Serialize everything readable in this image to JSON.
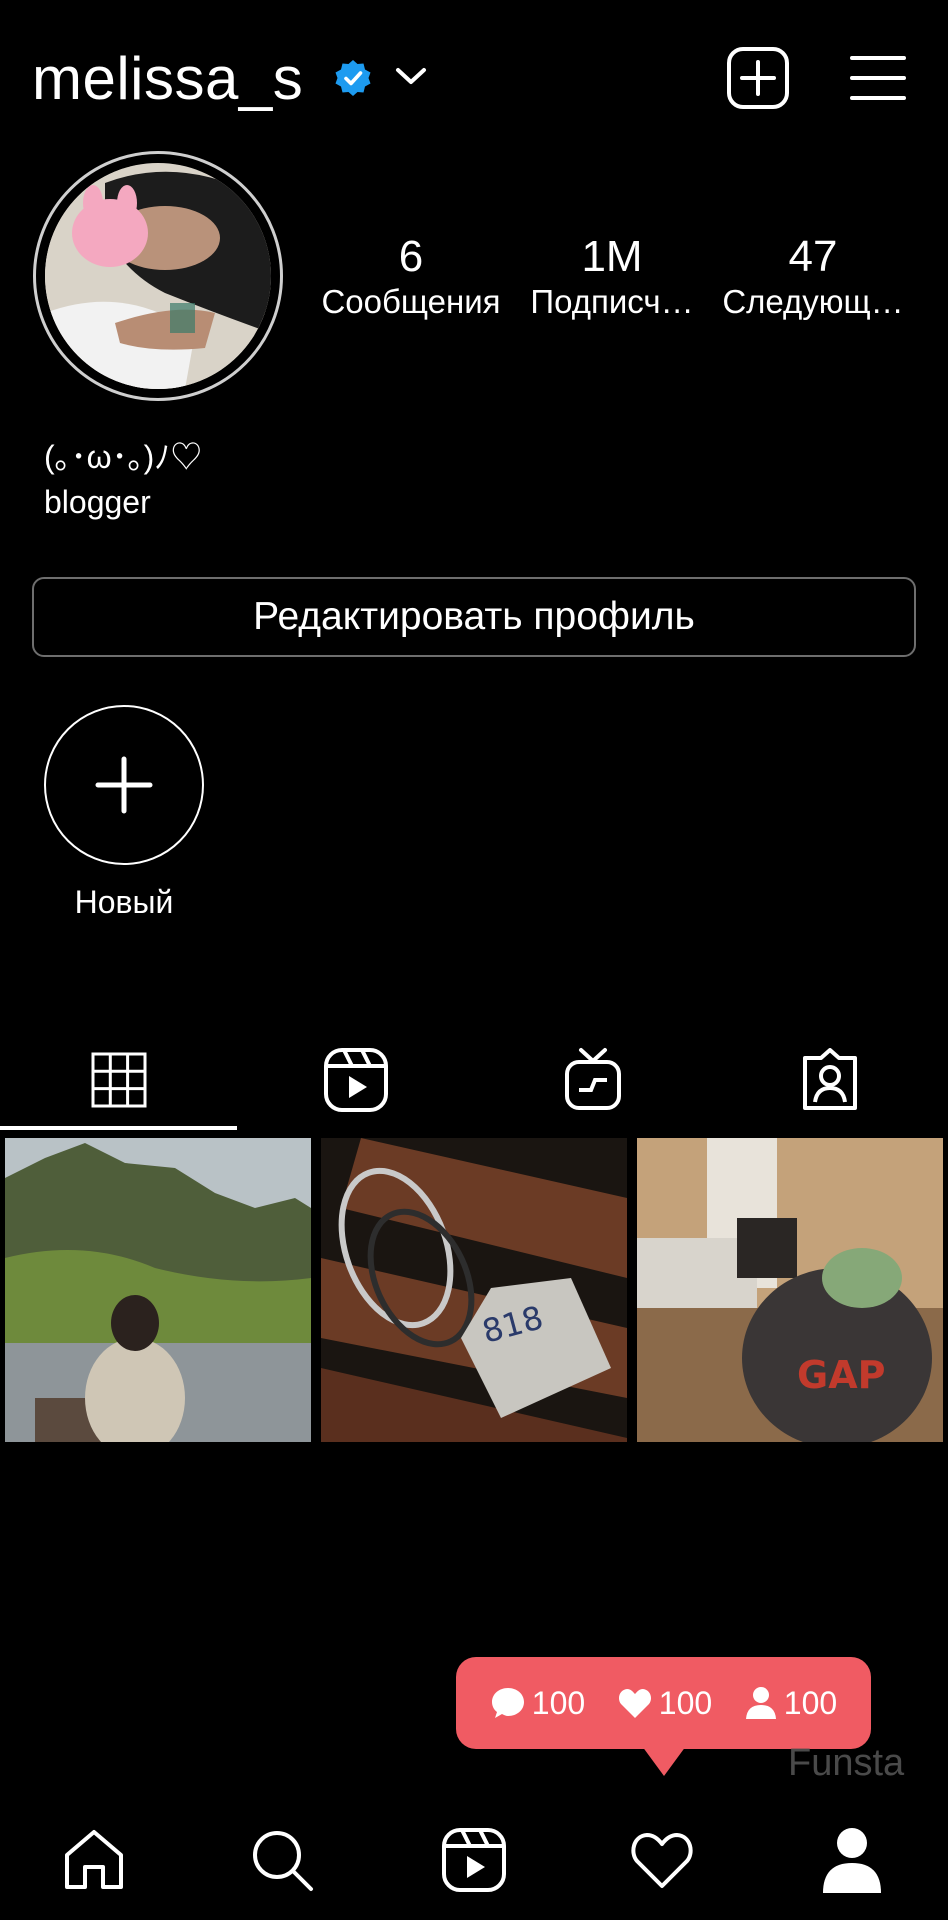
{
  "header": {
    "username": "melissa_s",
    "verified_icon": "verified-badge-icon",
    "accent_color": "#1d9bf0"
  },
  "stats": [
    {
      "value": "6",
      "label": "Сообщения"
    },
    {
      "value": "1M",
      "label": "Подписч…"
    },
    {
      "value": "47",
      "label": "Следующ…"
    }
  ],
  "bio": {
    "line1": "(｡･ω･｡)ﾉ♡",
    "line2": "blogger"
  },
  "edit_profile_label": "Редактировать профиль",
  "highlight": {
    "new_label": "Новый"
  },
  "tabs": [
    "grid-icon",
    "reels-icon",
    "igtv-icon",
    "tagged-icon"
  ],
  "notification": {
    "comments": "100",
    "likes": "100",
    "followers": "100",
    "color": "#f05b63"
  },
  "watermark": "Funsta",
  "bottom_nav": [
    "home-icon",
    "search-icon",
    "reels-icon",
    "heart-icon",
    "profile-icon"
  ]
}
